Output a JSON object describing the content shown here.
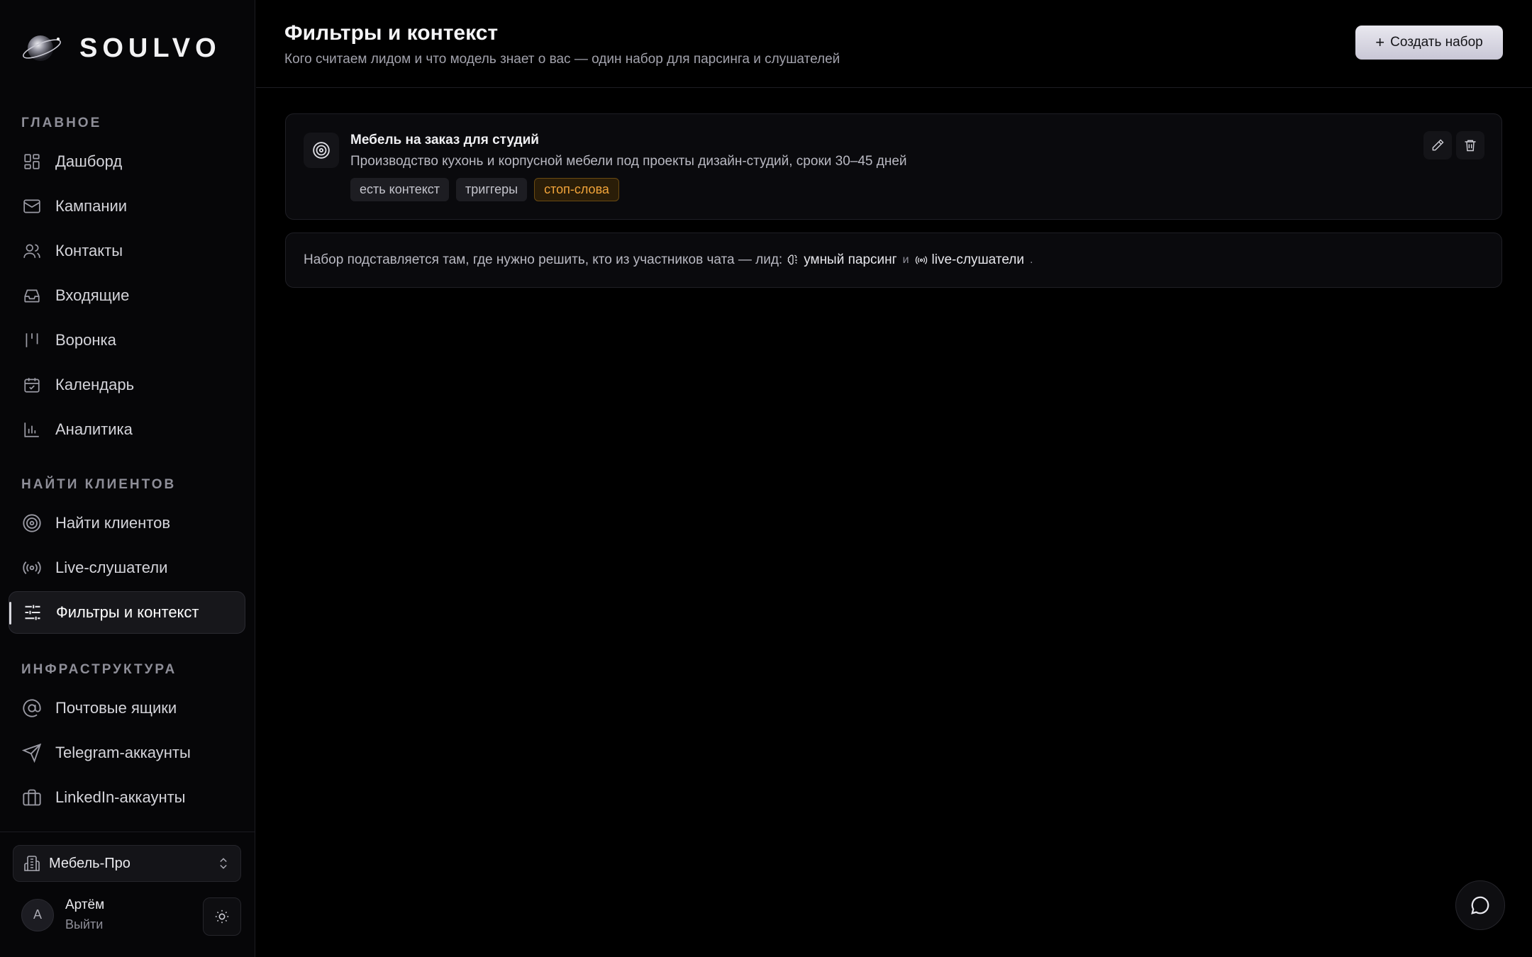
{
  "brand": {
    "name": "SOULVO"
  },
  "sidebar": {
    "sections": [
      {
        "title": "ГЛАВНОЕ"
      },
      {
        "title": "НАЙТИ КЛИЕНТОВ"
      },
      {
        "title": "ИНФРАСТРУКТУРА"
      }
    ],
    "items": [
      {
        "label": "Дашборд",
        "icon": "dashboard-icon"
      },
      {
        "label": "Кампании",
        "icon": "mail-icon"
      },
      {
        "label": "Контакты",
        "icon": "users-icon"
      },
      {
        "label": "Входящие",
        "icon": "inbox-icon"
      },
      {
        "label": "Воронка",
        "icon": "kanban-icon"
      },
      {
        "label": "Календарь",
        "icon": "calendar-icon"
      },
      {
        "label": "Аналитика",
        "icon": "bar-chart-icon"
      },
      {
        "label": "Найти клиентов",
        "icon": "target-icon"
      },
      {
        "label": "Live-слушатели",
        "icon": "broadcast-icon"
      },
      {
        "label": "Фильтры и контекст",
        "icon": "sliders-icon",
        "active": true
      },
      {
        "label": "Почтовые ящики",
        "icon": "at-sign-icon"
      },
      {
        "label": "Telegram-аккаунты",
        "icon": "send-icon"
      },
      {
        "label": "LinkedIn-аккаунты",
        "icon": "briefcase-icon"
      }
    ],
    "workspace": {
      "label": "Мебель-Про",
      "icon": "building-icon"
    },
    "user": {
      "initial": "А",
      "name": "Артём",
      "logout": "Выйти"
    }
  },
  "header": {
    "title": "Фильтры и контекст",
    "subtitle": "Кого считаем лидом и что модель знает о вас — один набор для парсинга и слушателей",
    "create_button": "Создать набор"
  },
  "card": {
    "title": "Мебель на заказ для студий",
    "description": "Производство кухонь и корпусной мебели под проекты дизайн-студий, сроки 30–45 дней",
    "tags": [
      "есть контекст",
      "триггеры",
      "стоп-слова"
    ]
  },
  "info": {
    "text": "Набор подставляется там, где нужно решить, кто из участников чата — лид:",
    "chip1": "умный парсинг",
    "joiner": "и",
    "chip2": "live-слушатели",
    "end": "."
  },
  "colors": {
    "accent_warning": "#f2a43a",
    "background": "#000000"
  }
}
